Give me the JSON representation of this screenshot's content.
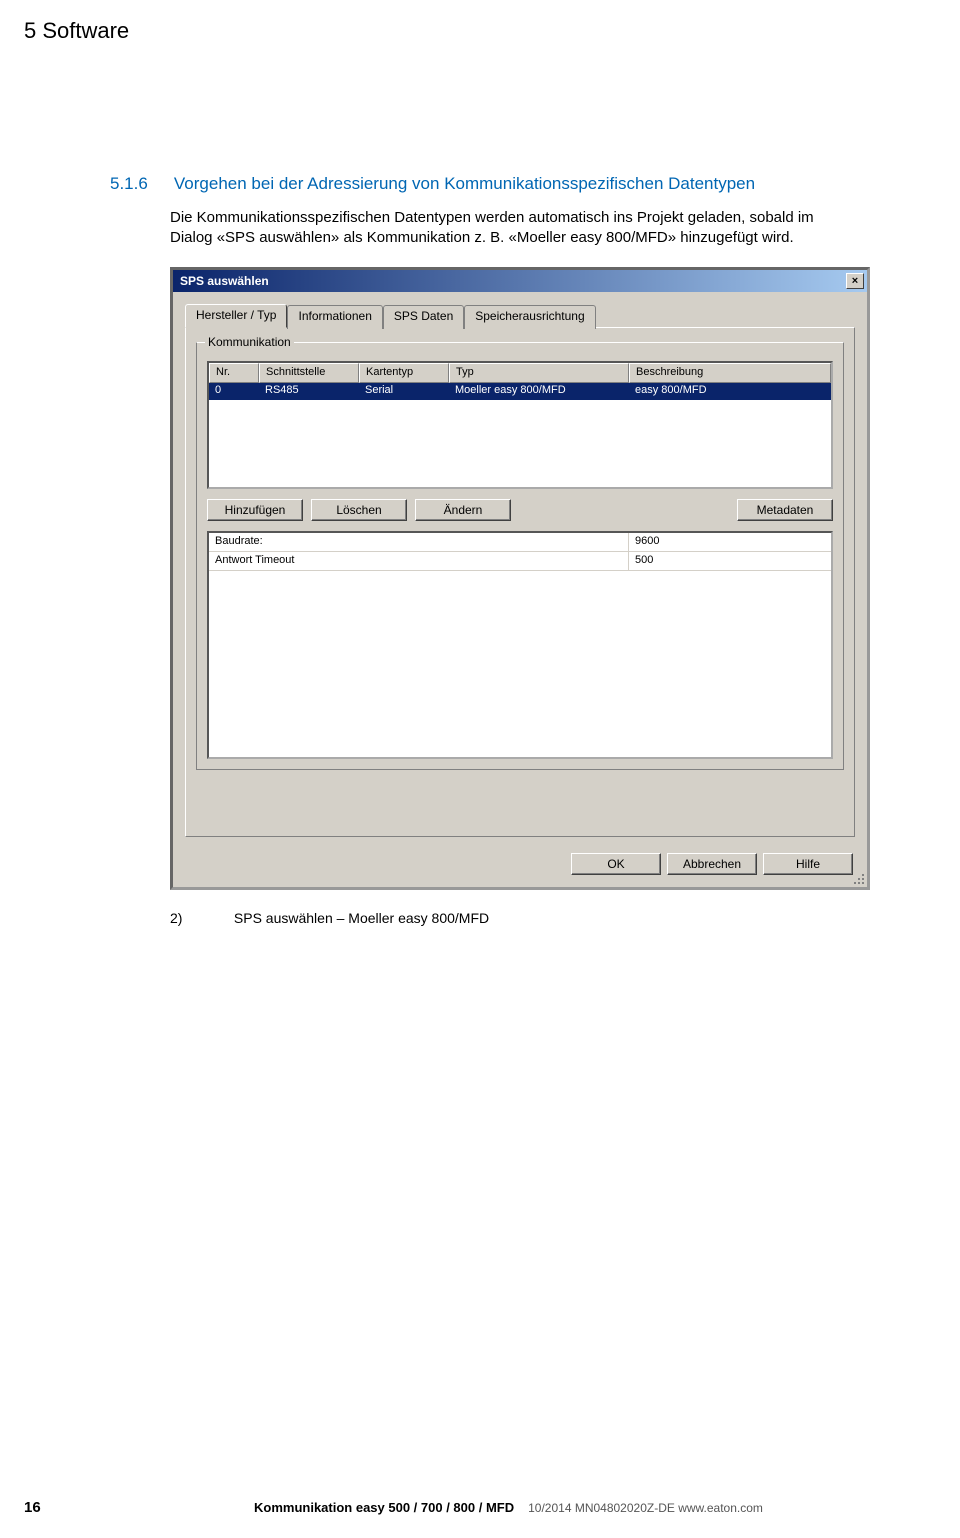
{
  "header": {
    "chapter": "5 Software"
  },
  "section": {
    "number": "5.1.6",
    "title": "Vorgehen bei der Adressierung von Kommunikationsspezifischen Datentypen",
    "body": "Die Kommunikationsspezifischen Datentypen werden automatisch ins Projekt geladen, sobald im Dialog «SPS auswählen» als Kommunikation z. B. «Moeller easy 800/MFD» hinzugefügt wird."
  },
  "dialog": {
    "title": "SPS auswählen",
    "close": "×",
    "tabs": [
      "Hersteller / Typ",
      "Informationen",
      "SPS Daten",
      "Speicherausrichtung"
    ],
    "group_label": "Kommunikation",
    "columns": {
      "nr": "Nr.",
      "schnitt": "Schnittstelle",
      "kartentyp": "Kartentyp",
      "typ": "Typ",
      "besch": "Beschreibung"
    },
    "row": {
      "nr": "0",
      "schnitt": "RS485",
      "kartentyp": "Serial",
      "typ": "Moeller easy 800/MFD",
      "besch": "easy 800/MFD"
    },
    "buttons": {
      "add": "Hinzufügen",
      "del": "Löschen",
      "edit": "Ändern",
      "meta": "Metadaten"
    },
    "props": {
      "baud_label": "Baudrate:",
      "baud_val": "9600",
      "timeout_label": "Antwort Timeout",
      "timeout_val": "500"
    },
    "dlg_buttons": {
      "ok": "OK",
      "cancel": "Abbrechen",
      "help": "Hilfe"
    }
  },
  "caption": {
    "num": "2)",
    "text": "SPS auswählen – Moeller easy 800/MFD"
  },
  "footer": {
    "page": "16",
    "doc": "Kommunikation easy 500 / 700 / 800 / MFD",
    "rest": "10/2014 MN04802020Z-DE    www.eaton.com"
  }
}
